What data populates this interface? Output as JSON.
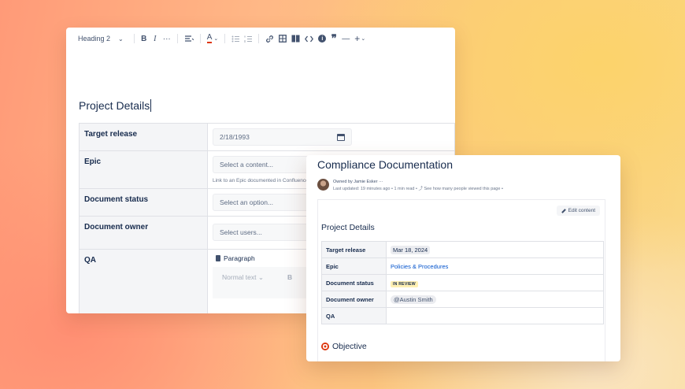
{
  "editor": {
    "toolbar": {
      "heading_label": "Heading 2",
      "bold": "B",
      "italic": "I",
      "more": "···",
      "text_color": "A",
      "info": "i",
      "quote": "❞",
      "divider": "—",
      "insert": "+"
    },
    "page_title": "Project Details",
    "rows": [
      {
        "label": "Target release",
        "value": "2/18/1993"
      },
      {
        "label": "Epic",
        "placeholder": "Select a content...",
        "helper": "Link to an Epic documented in Confluence"
      },
      {
        "label": "Document status",
        "placeholder": "Select an option..."
      },
      {
        "label": "Document owner",
        "placeholder": "Select users..."
      },
      {
        "label": "QA",
        "block_type": "Paragraph",
        "inner_text_style": "Normal text",
        "inner_bold": "B"
      }
    ]
  },
  "page": {
    "title": "Compliance Documentation",
    "owned_by": "Owned by Jamie Esker",
    "owner_menu": "···",
    "last_updated": "Last updated: 19 minutes ago",
    "read_time": "1 min read",
    "views": "See how many people viewed this page",
    "edit_button": "Edit content",
    "section_title": "Project Details",
    "rows": [
      {
        "label": "Target release",
        "value": "Mar 18, 2024"
      },
      {
        "label": "Epic",
        "value": "Policies & Procedures"
      },
      {
        "label": "Document status",
        "value": "IN REVIEW"
      },
      {
        "label": "Document owner",
        "value": "@Austin Smith"
      },
      {
        "label": "QA",
        "value": ""
      }
    ],
    "objective_heading": "Objective"
  },
  "icons": [
    "chevron-down-icon",
    "bullet-list-icon",
    "numbered-list-icon",
    "link-icon",
    "table-icon",
    "layout-icon",
    "code-icon",
    "info-icon",
    "quote-icon",
    "divider-icon",
    "plus-icon",
    "calendar-icon",
    "paragraph-icon",
    "pencil-icon",
    "target-icon",
    "chart-icon"
  ],
  "colors": {
    "accent_link": "#0052cc",
    "status_in_review": "#fff0b3",
    "text_primary": "#172b4d"
  }
}
